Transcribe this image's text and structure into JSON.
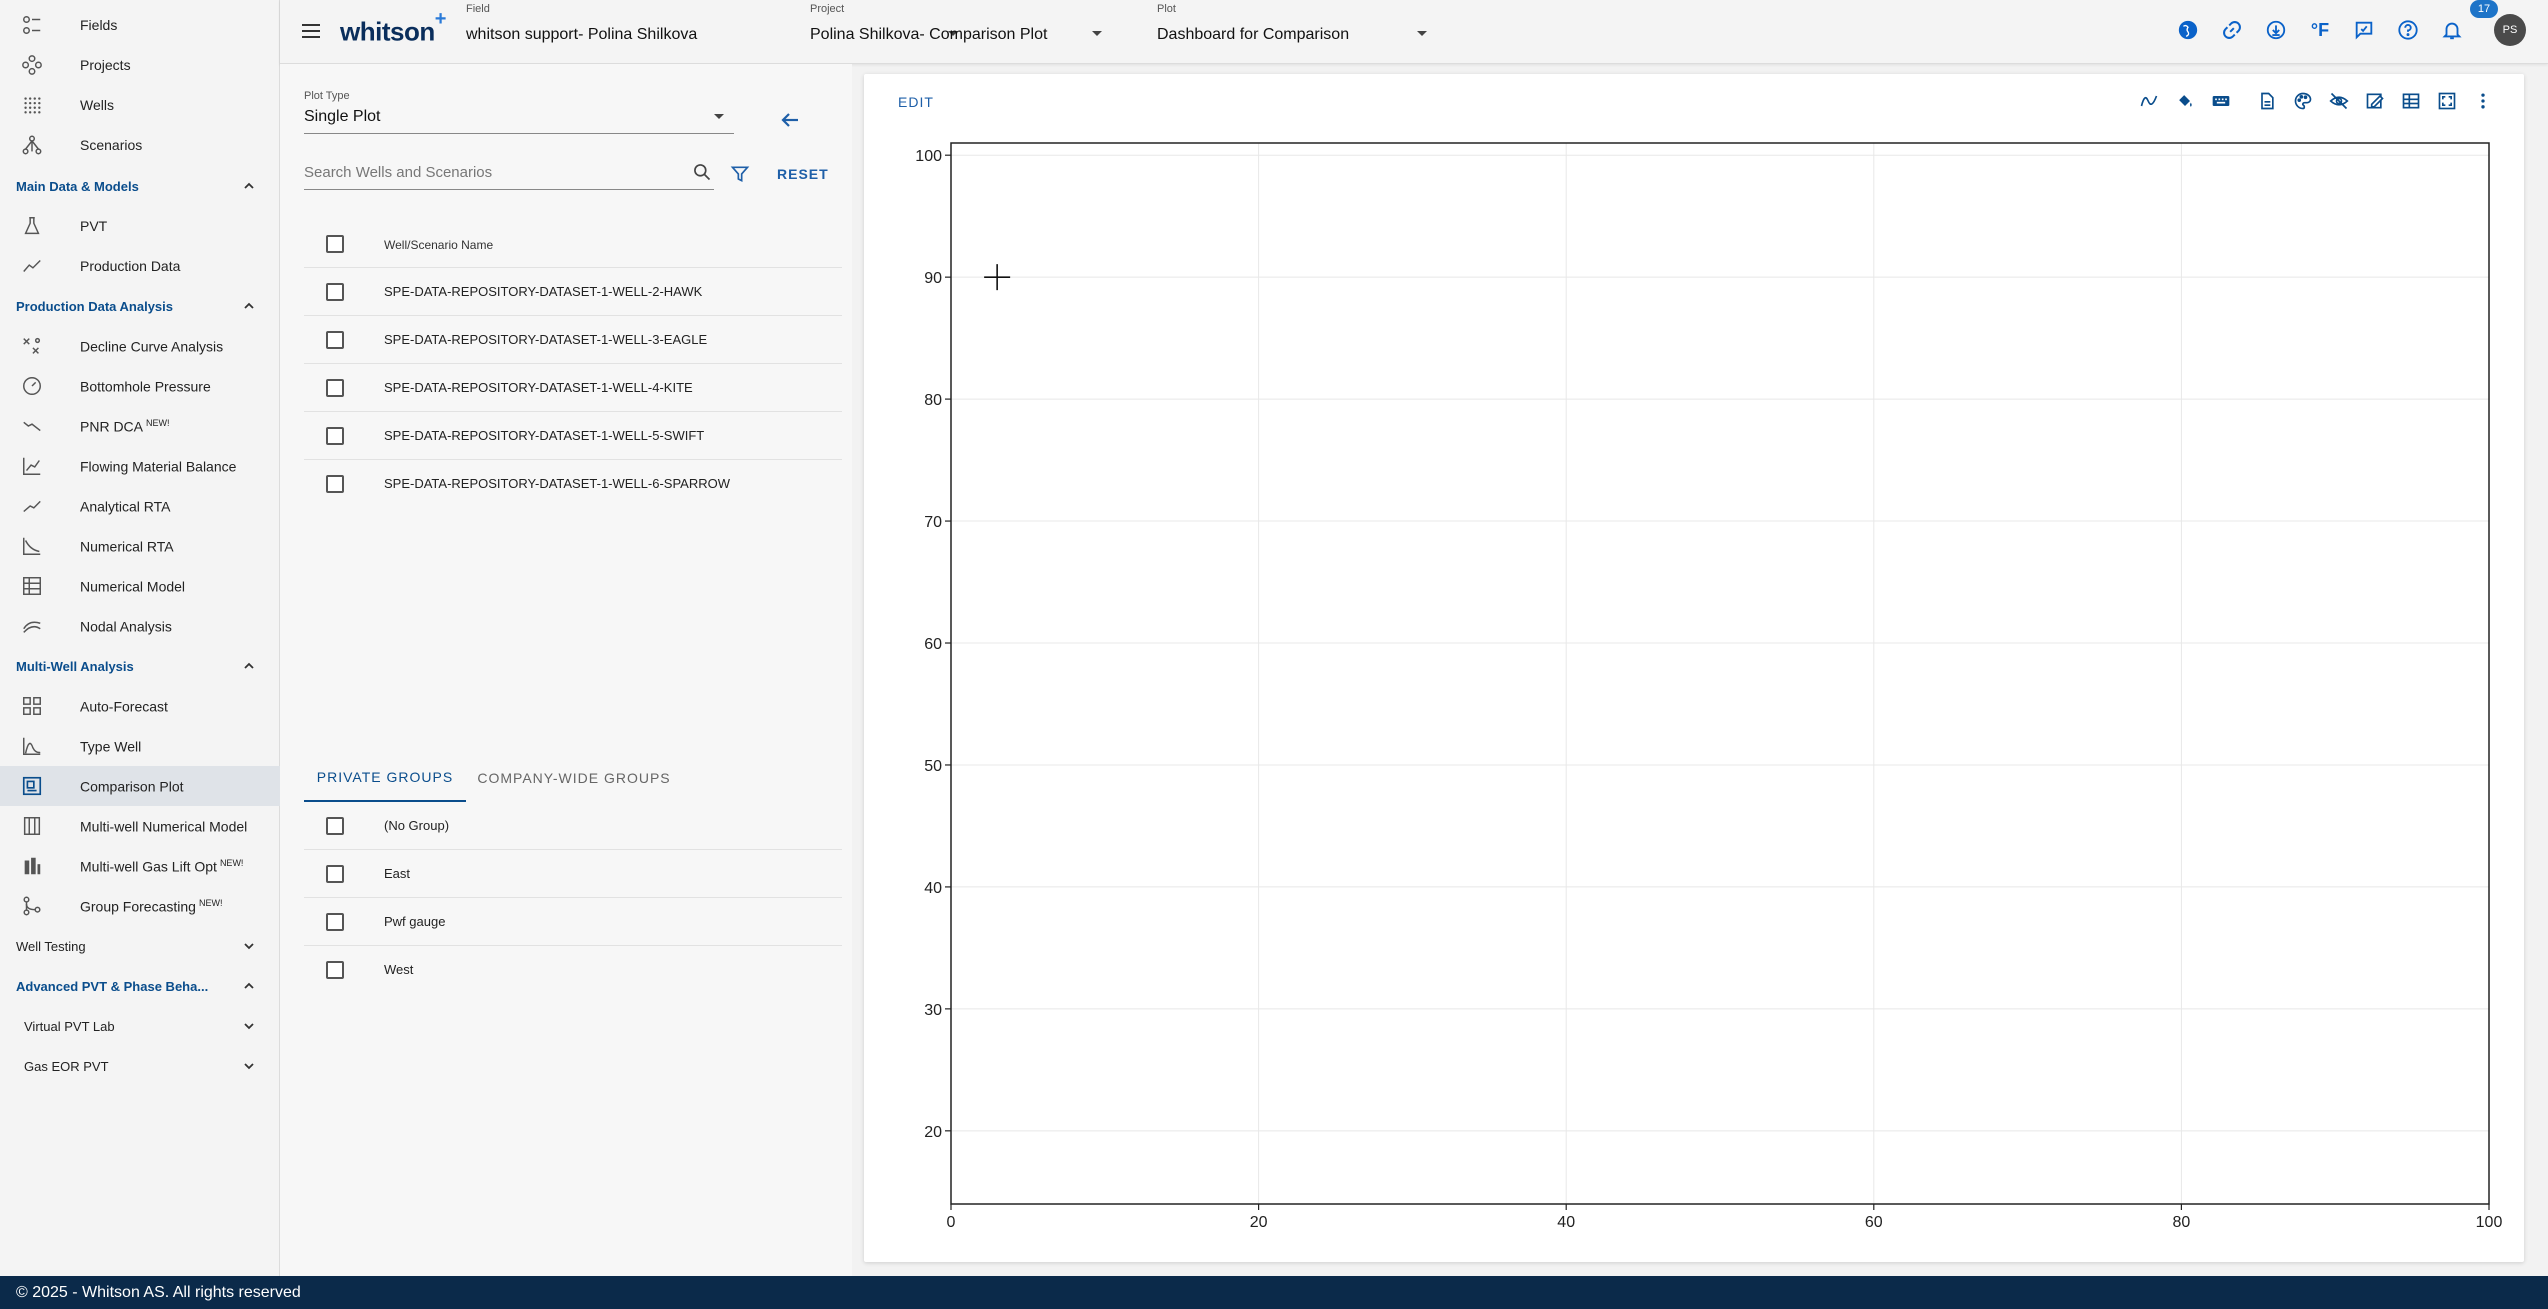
{
  "sidebar": {
    "top_items": [
      {
        "label": "Fields",
        "icon": "fields-icon"
      },
      {
        "label": "Projects",
        "icon": "projects-icon"
      },
      {
        "label": "Wells",
        "icon": "wells-icon"
      },
      {
        "label": "Scenarios",
        "icon": "scenarios-icon"
      }
    ],
    "sections": {
      "main_data": {
        "label": "Main Data & Models",
        "items": [
          {
            "label": "PVT",
            "icon": "flask-icon"
          },
          {
            "label": "Production Data",
            "icon": "line-chart-icon"
          }
        ]
      },
      "pda": {
        "label": "Production Data Analysis",
        "items": [
          {
            "label": "Decline Curve Analysis",
            "icon": "decline-curve-icon",
            "badge": ""
          },
          {
            "label": "Bottomhole Pressure",
            "icon": "gauge-icon",
            "badge": ""
          },
          {
            "label": "PNR DCA",
            "icon": "trend-down-icon",
            "badge": "NEW!"
          },
          {
            "label": "Flowing Material Balance",
            "icon": "fmb-icon",
            "badge": ""
          },
          {
            "label": "Analytical RTA",
            "icon": "rta-icon",
            "badge": ""
          },
          {
            "label": "Numerical RTA",
            "icon": "numerical-rta-icon",
            "badge": ""
          },
          {
            "label": "Numerical Model",
            "icon": "grid-model-icon",
            "badge": ""
          },
          {
            "label": "Nodal Analysis",
            "icon": "nodal-icon",
            "badge": ""
          }
        ]
      },
      "mwa": {
        "label": "Multi-Well Analysis",
        "items": [
          {
            "label": "Auto-Forecast",
            "icon": "auto-forecast-icon",
            "badge": ""
          },
          {
            "label": "Type Well",
            "icon": "type-well-icon",
            "badge": ""
          },
          {
            "label": "Comparison Plot",
            "icon": "comparison-plot-icon",
            "badge": ""
          },
          {
            "label": "Multi-well Numerical Model",
            "icon": "multiwell-model-icon",
            "badge": ""
          },
          {
            "label": "Multi-well Gas Lift Opt",
            "icon": "gas-lift-icon",
            "badge": "NEW!"
          },
          {
            "label": "Group Forecasting",
            "icon": "group-forecast-icon",
            "badge": "NEW!"
          }
        ]
      },
      "well_testing": {
        "label": "Well Testing"
      },
      "advanced_pvt": {
        "label": "Advanced PVT & Phase Beha...",
        "items": [
          {
            "label": "Virtual PVT Lab"
          },
          {
            "label": "Gas EOR PVT"
          }
        ]
      }
    }
  },
  "header": {
    "logo": "whitson",
    "logo_plus": "+",
    "field": {
      "caption": "Field",
      "value": "whitson support- Polina Shilkova"
    },
    "project": {
      "caption": "Project",
      "value": "Polina Shilkova- Comparison Plot"
    },
    "plot": {
      "caption": "Plot",
      "value": "Dashboard for Comparison"
    },
    "icons": [
      "globe-icon",
      "link-icon",
      "download-icon",
      "fahrenheit-icon",
      "feedback-icon",
      "help-icon",
      "bell-icon"
    ],
    "fahrenheit_label": "°F",
    "notifications": "17",
    "avatar": "PS"
  },
  "left_panel": {
    "plot_type": {
      "caption": "Plot Type",
      "value": "Single Plot"
    },
    "search_placeholder": "Search Wells and Scenarios",
    "reset_label": "RESET",
    "table_header": "Well/Scenario Name",
    "wells": [
      "SPE-DATA-REPOSITORY-DATASET-1-WELL-2-HAWK",
      "SPE-DATA-REPOSITORY-DATASET-1-WELL-3-EAGLE",
      "SPE-DATA-REPOSITORY-DATASET-1-WELL-4-KITE",
      "SPE-DATA-REPOSITORY-DATASET-1-WELL-5-SWIFT",
      "SPE-DATA-REPOSITORY-DATASET-1-WELL-6-SPARROW"
    ],
    "tabs": [
      "PRIVATE GROUPS",
      "COMPANY-WIDE GROUPS"
    ],
    "groups": [
      "(No Group)",
      "East",
      "Pwf gauge",
      "West"
    ]
  },
  "chart_toolbar": {
    "edit_label": "EDIT",
    "icons": [
      "curve-icon",
      "fill-icon",
      "keyboard-icon",
      "document-icon",
      "palette-icon",
      "hide-icon",
      "annotate-icon",
      "table-icon",
      "fit-icon",
      "more-vert-icon"
    ]
  },
  "chart_data": {
    "type": "scatter",
    "series": [],
    "xlim": [
      0,
      100
    ],
    "ylim": [
      14,
      101
    ],
    "x_ticks": [
      0,
      20,
      40,
      60,
      80,
      100
    ],
    "y_ticks": [
      20,
      30,
      40,
      50,
      60,
      70,
      80,
      90,
      100
    ],
    "grid": true,
    "crosshair_cursor": {
      "x": 3,
      "y": 90
    }
  },
  "colors": {
    "accent": "#0a4d8c",
    "footer_bg": "#0b2a4a",
    "active_nav": "#dfe3e8"
  },
  "footer": {
    "text": "© 2025 - Whitson AS. All rights reserved"
  }
}
